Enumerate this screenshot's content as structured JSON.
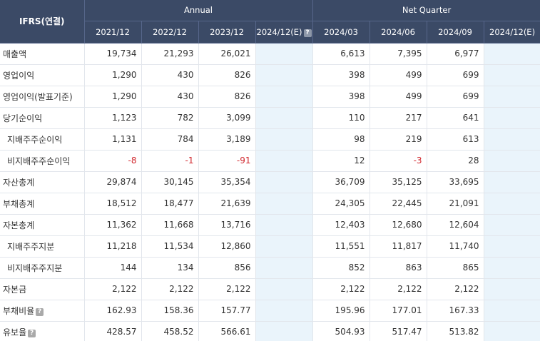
{
  "header": {
    "corner": "IFRS(연결)",
    "annual": "Annual",
    "quarter": "Net Quarter",
    "annual_periods": [
      "2021/12",
      "2022/12",
      "2023/12",
      "2024/12(E)"
    ],
    "quarter_periods": [
      "2024/03",
      "2024/06",
      "2024/09",
      "2024/12(E)"
    ],
    "help_icon_text": "?"
  },
  "rows": [
    {
      "label": "매출액",
      "sub": false,
      "help": false,
      "annual": [
        "19,734",
        "21,293",
        "26,021",
        ""
      ],
      "quarter": [
        "6,613",
        "7,395",
        "6,977",
        ""
      ]
    },
    {
      "label": "영업이익",
      "sub": false,
      "help": false,
      "annual": [
        "1,290",
        "430",
        "826",
        ""
      ],
      "quarter": [
        "398",
        "499",
        "699",
        ""
      ]
    },
    {
      "label": "영업이익(발표기준)",
      "sub": false,
      "help": false,
      "annual": [
        "1,290",
        "430",
        "826",
        ""
      ],
      "quarter": [
        "398",
        "499",
        "699",
        ""
      ]
    },
    {
      "label": "당기순이익",
      "sub": false,
      "help": false,
      "annual": [
        "1,123",
        "782",
        "3,099",
        ""
      ],
      "quarter": [
        "110",
        "217",
        "641",
        ""
      ]
    },
    {
      "label": "지배주주순이익",
      "sub": true,
      "help": false,
      "annual": [
        "1,131",
        "784",
        "3,189",
        ""
      ],
      "quarter": [
        "98",
        "219",
        "613",
        ""
      ]
    },
    {
      "label": "비지배주주순이익",
      "sub": true,
      "help": false,
      "annual": [
        "-8",
        "-1",
        "-91",
        ""
      ],
      "quarter": [
        "12",
        "-3",
        "28",
        ""
      ]
    },
    {
      "label": "자산총계",
      "sub": false,
      "help": false,
      "annual": [
        "29,874",
        "30,145",
        "35,354",
        ""
      ],
      "quarter": [
        "36,709",
        "35,125",
        "33,695",
        ""
      ]
    },
    {
      "label": "부채총계",
      "sub": false,
      "help": false,
      "annual": [
        "18,512",
        "18,477",
        "21,639",
        ""
      ],
      "quarter": [
        "24,305",
        "22,445",
        "21,091",
        ""
      ]
    },
    {
      "label": "자본총계",
      "sub": false,
      "help": false,
      "annual": [
        "11,362",
        "11,668",
        "13,716",
        ""
      ],
      "quarter": [
        "12,403",
        "12,680",
        "12,604",
        ""
      ]
    },
    {
      "label": "지배주주지분",
      "sub": true,
      "help": false,
      "annual": [
        "11,218",
        "11,534",
        "12,860",
        ""
      ],
      "quarter": [
        "11,551",
        "11,817",
        "11,740",
        ""
      ]
    },
    {
      "label": "비지배주주지분",
      "sub": true,
      "help": false,
      "annual": [
        "144",
        "134",
        "856",
        ""
      ],
      "quarter": [
        "852",
        "863",
        "865",
        ""
      ]
    },
    {
      "label": "자본금",
      "sub": false,
      "help": false,
      "annual": [
        "2,122",
        "2,122",
        "2,122",
        ""
      ],
      "quarter": [
        "2,122",
        "2,122",
        "2,122",
        ""
      ]
    },
    {
      "label": "부채비율",
      "sub": false,
      "help": true,
      "annual": [
        "162.93",
        "158.36",
        "157.77",
        ""
      ],
      "quarter": [
        "195.96",
        "177.01",
        "167.33",
        ""
      ]
    },
    {
      "label": "유보율",
      "sub": false,
      "help": true,
      "annual": [
        "428.57",
        "458.52",
        "566.61",
        ""
      ],
      "quarter": [
        "504.93",
        "517.47",
        "513.82",
        ""
      ]
    }
  ]
}
